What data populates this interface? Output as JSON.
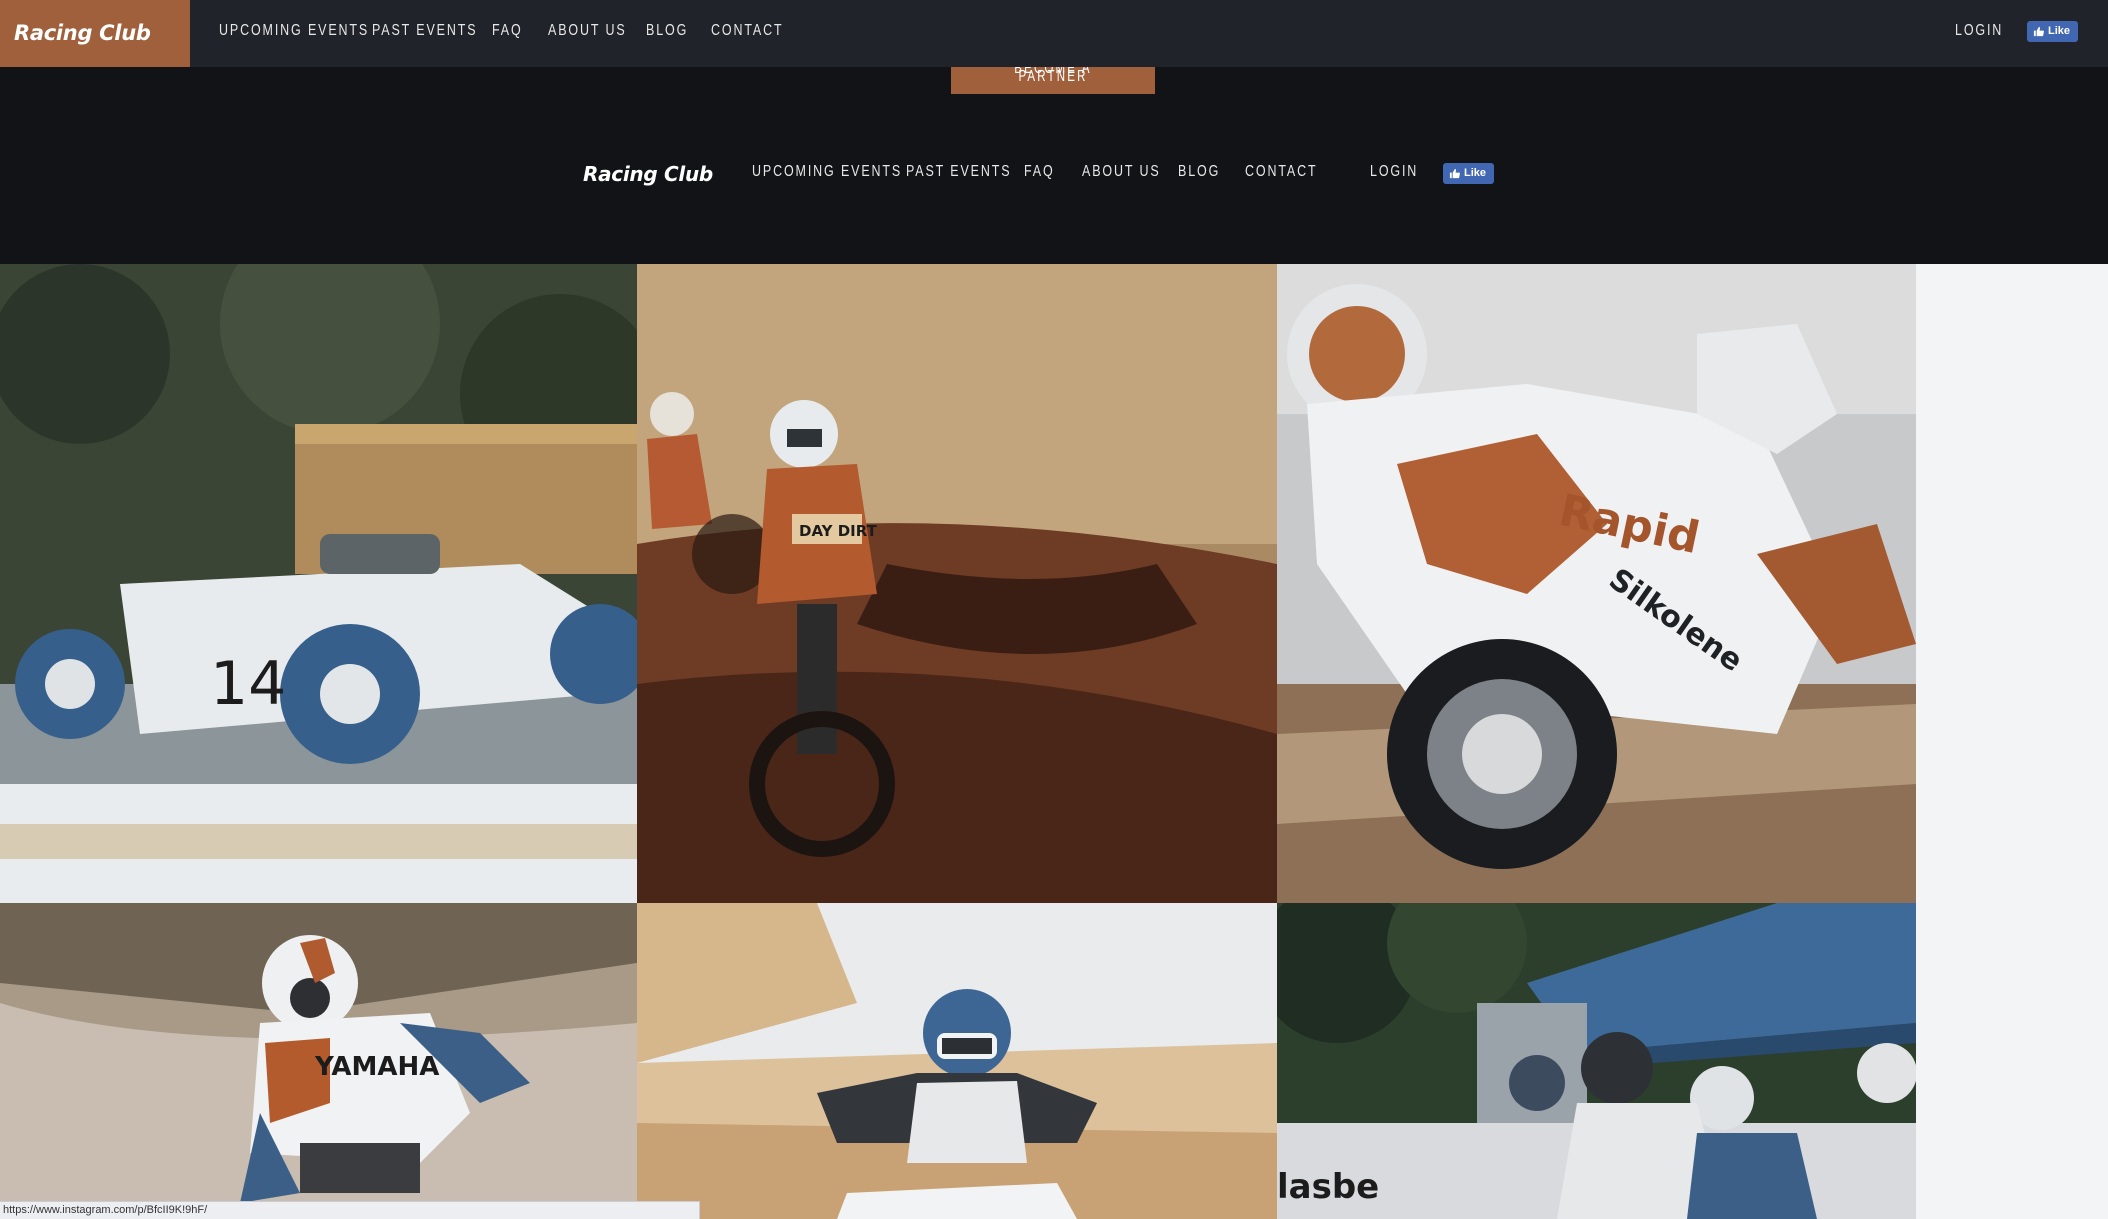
{
  "topbar": {
    "brand": "Racing Club",
    "nav": [
      "UPCOMING EVENTS",
      "PAST EVENTS",
      "FAQ",
      "ABOUT US",
      "BLOG",
      "CONTACT"
    ],
    "login": "LOGIN",
    "like": "Like"
  },
  "header": {
    "partner_button": "BECOME A PARTNER",
    "brand": "Racing Club",
    "nav": [
      "UPCOMING EVENTS",
      "PAST EVENTS",
      "FAQ",
      "ABOUT US",
      "BLOG",
      "CONTACT"
    ],
    "login": "LOGIN",
    "like": "Like"
  },
  "gallery": {
    "photos": [
      {
        "name": "photo-vintage-race-car",
        "label": "14"
      },
      {
        "name": "photo-motocross-riders",
        "label": "DAY DIRT"
      },
      {
        "name": "photo-superbike",
        "label": "Rapid"
      },
      {
        "name": "photo-yamaha-rider",
        "label": "YAMAHA"
      },
      {
        "name": "photo-motocross-dust",
        "label": ""
      },
      {
        "name": "photo-race-start",
        "label": ""
      }
    ]
  },
  "status_bar": {
    "url": "https://www.instagram.com/p/BfcII9K!9hF/"
  },
  "colors": {
    "accent": "#a0603c",
    "topbar_bg": "#20232a",
    "header_bg": "#111317",
    "facebook": "#4267b2"
  }
}
